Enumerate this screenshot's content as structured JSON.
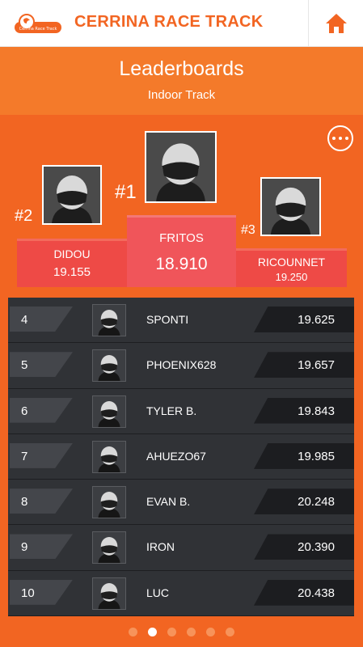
{
  "app": {
    "title": "CERRINA RACE TRACK",
    "logo_text": "Cerrina Race Track",
    "brand_color": "#f26522"
  },
  "header": {
    "title": "Leaderboards",
    "subtitle": "Indoor Track"
  },
  "more_icon": "more-icon",
  "podium": {
    "first": {
      "rank": "#1",
      "name": "FRITOS",
      "time": "18.910"
    },
    "second": {
      "rank": "#2",
      "name": "DIDOU",
      "time": "19.155"
    },
    "third": {
      "rank": "#3",
      "name": "RICOUNNET",
      "time": "19.250"
    }
  },
  "leaderboard": [
    {
      "rank": "4",
      "name": "SPONTI",
      "time": "19.625"
    },
    {
      "rank": "5",
      "name": "PHOENIX628",
      "time": "19.657"
    },
    {
      "rank": "6",
      "name": "TYLER B.",
      "time": "19.843"
    },
    {
      "rank": "7",
      "name": "AHUEZO67",
      "time": "19.985"
    },
    {
      "rank": "8",
      "name": "EVAN B.",
      "time": "20.248"
    },
    {
      "rank": "9",
      "name": "IRON",
      "time": "20.390"
    },
    {
      "rank": "10",
      "name": "LUC",
      "time": "20.438"
    }
  ],
  "pager": {
    "count": 6,
    "active_index": 1
  }
}
